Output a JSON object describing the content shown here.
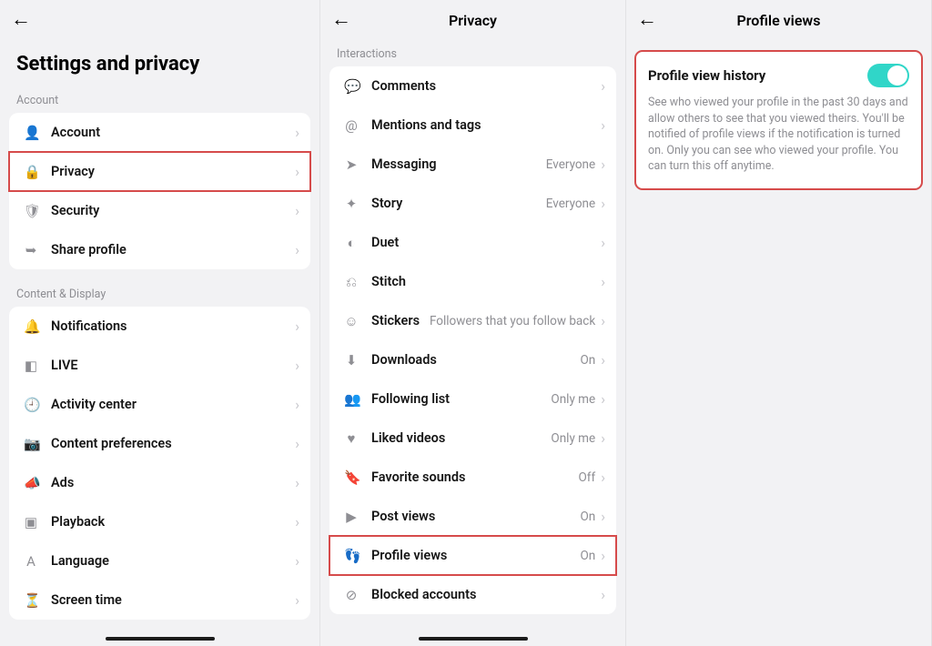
{
  "panel1": {
    "title": "Settings and privacy",
    "sections": [
      {
        "label": "Account",
        "items": [
          {
            "icon": "person-icon",
            "glyph": "👤",
            "label": "Account"
          },
          {
            "icon": "lock-icon",
            "glyph": "🔒",
            "label": "Privacy",
            "highlighted": true
          },
          {
            "icon": "shield-icon",
            "glyph": "🛡",
            "label": "Security"
          },
          {
            "icon": "share-icon",
            "glyph": "➥",
            "label": "Share profile"
          }
        ]
      },
      {
        "label": "Content & Display",
        "items": [
          {
            "icon": "bell-icon",
            "glyph": "🔔",
            "label": "Notifications"
          },
          {
            "icon": "live-icon",
            "glyph": "◧",
            "label": "LIVE"
          },
          {
            "icon": "clock-icon",
            "glyph": "🕘",
            "label": "Activity center"
          },
          {
            "icon": "camera-icon",
            "glyph": "📷",
            "label": "Content preferences"
          },
          {
            "icon": "megaphone-icon",
            "glyph": "📣",
            "label": "Ads"
          },
          {
            "icon": "playback-icon",
            "glyph": "▣",
            "label": "Playback"
          },
          {
            "icon": "language-icon",
            "glyph": "A",
            "label": "Language"
          },
          {
            "icon": "hourglass-icon",
            "glyph": "⏳",
            "label": "Screen time"
          }
        ]
      }
    ]
  },
  "panel2": {
    "title": "Privacy",
    "section_label": "Interactions",
    "items": [
      {
        "icon": "comment-icon",
        "glyph": "💬",
        "label": "Comments",
        "value": ""
      },
      {
        "icon": "at-icon",
        "glyph": "@",
        "label": "Mentions and tags",
        "value": ""
      },
      {
        "icon": "send-icon",
        "glyph": "➤",
        "label": "Messaging",
        "value": "Everyone"
      },
      {
        "icon": "story-icon",
        "glyph": "✦",
        "label": "Story",
        "value": "Everyone"
      },
      {
        "icon": "duet-icon",
        "glyph": "◐",
        "label": "Duet",
        "value": ""
      },
      {
        "icon": "stitch-icon",
        "glyph": "⎌",
        "label": "Stitch",
        "value": ""
      },
      {
        "icon": "stickers-icon",
        "glyph": "☺",
        "label": "Stickers",
        "value": "Followers that you follow back"
      },
      {
        "icon": "download-icon",
        "glyph": "⬇",
        "label": "Downloads",
        "value": "On"
      },
      {
        "icon": "following-icon",
        "glyph": "👥",
        "label": "Following list",
        "value": "Only me"
      },
      {
        "icon": "heart-icon",
        "glyph": "♥",
        "label": "Liked videos",
        "value": "Only me"
      },
      {
        "icon": "bookmark-icon",
        "glyph": "🔖",
        "label": "Favorite sounds",
        "value": "Off"
      },
      {
        "icon": "play-icon",
        "glyph": "▶",
        "label": "Post views",
        "value": "On"
      },
      {
        "icon": "footsteps-icon",
        "glyph": "👣",
        "label": "Profile views",
        "value": "On",
        "highlighted": true
      },
      {
        "icon": "blocked-icon",
        "glyph": "⊘",
        "label": "Blocked accounts",
        "value": ""
      }
    ]
  },
  "panel3": {
    "title": "Profile views",
    "card_title": "Profile view history",
    "toggle_on": true,
    "description": "See who viewed your profile in the past 30 days and allow others to see that you viewed theirs. You'll be notified of profile views if the notification is turned on. Only you can see who viewed your profile. You can turn this off anytime."
  }
}
